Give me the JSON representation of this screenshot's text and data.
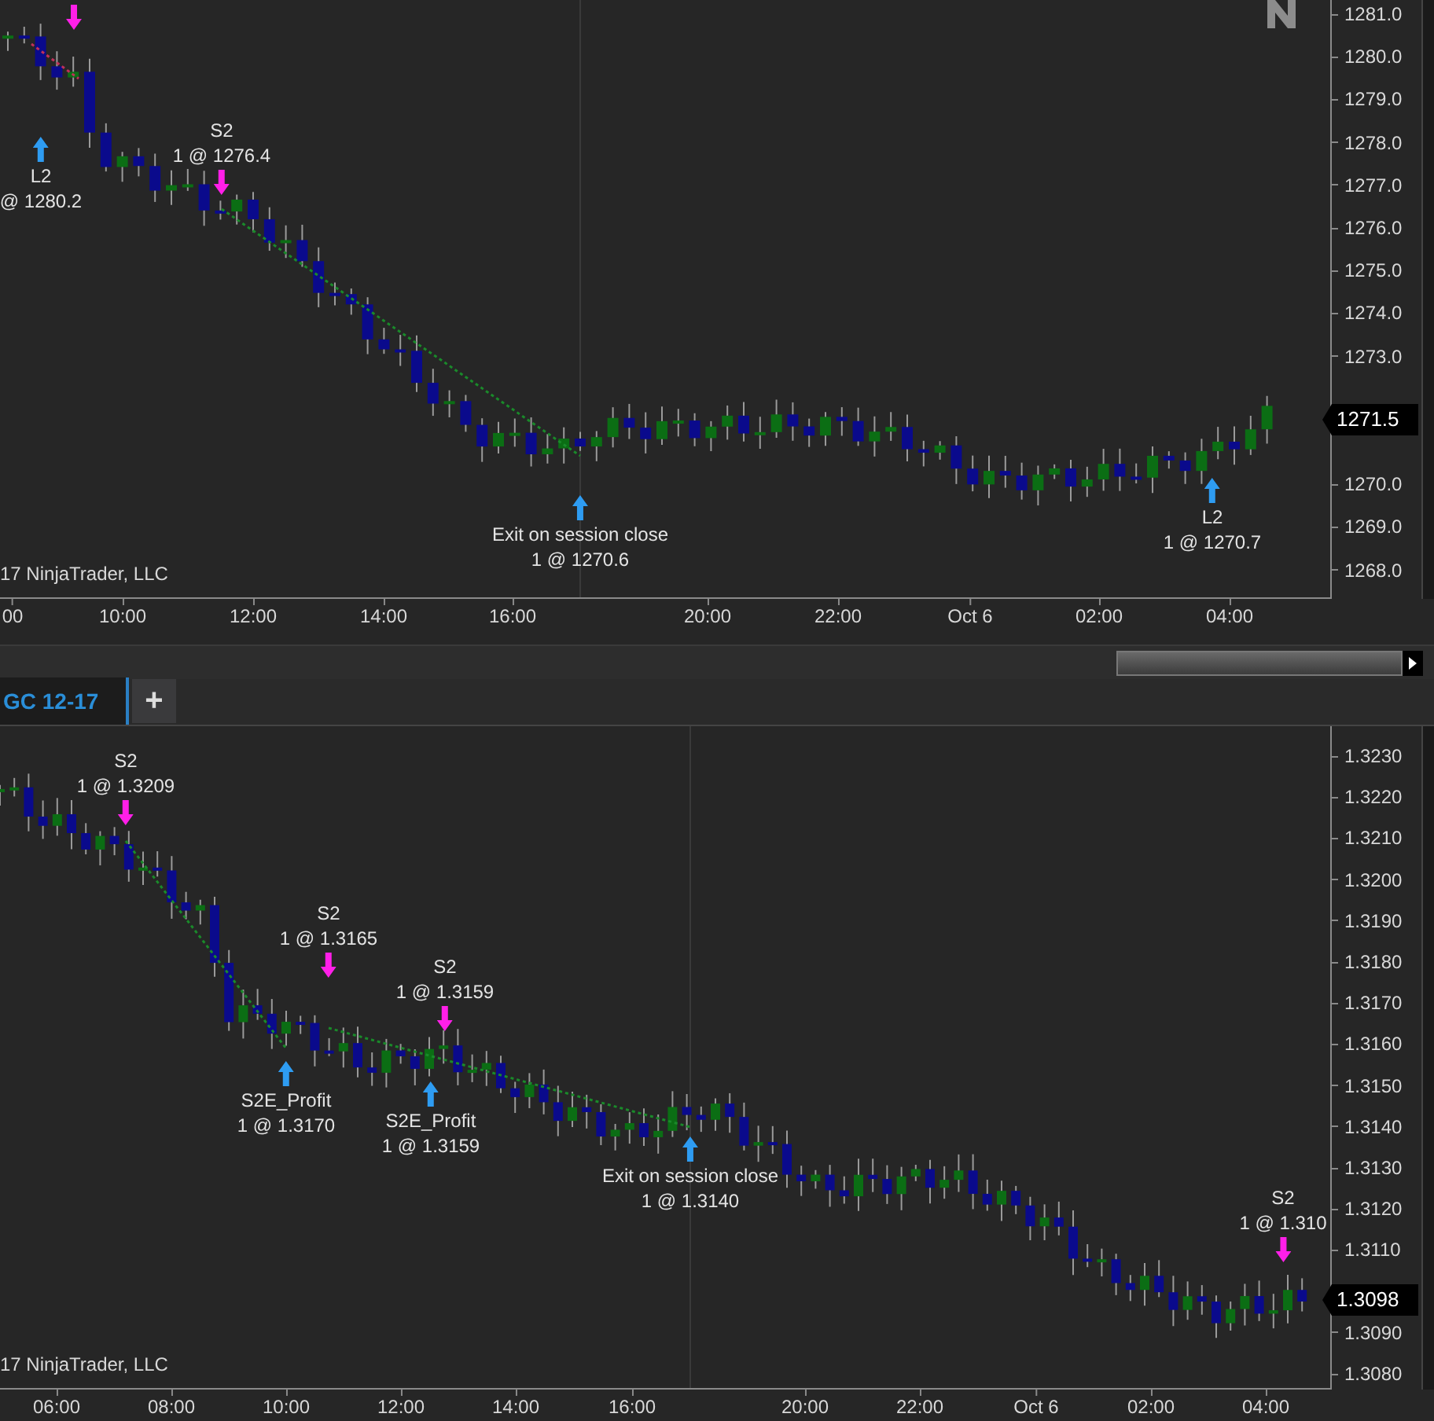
{
  "top_chart": {
    "copyright": "17 NinjaTrader, LLC",
    "price_axis": {
      "labels": [
        "1281.0",
        "1280.0",
        "1279.0",
        "1278.0",
        "1277.0",
        "1276.0",
        "1275.0",
        "1274.0",
        "1273.0",
        "1270.0",
        "1269.0",
        "1268.0"
      ],
      "current_price": "1271.5"
    },
    "time_axis": [
      "00",
      "10:00",
      "12:00",
      "14:00",
      "16:00",
      "20:00",
      "22:00",
      "Oct 6",
      "02:00",
      "04:00"
    ],
    "trades": [
      {
        "kind": "sell"
      },
      {
        "kind": "buy",
        "label": "L2",
        "detail": "@ 1280.2"
      },
      {
        "kind": "sell",
        "label": "S2",
        "detail": "1 @ 1276.4"
      },
      {
        "kind": "buy",
        "label": "Exit on session close",
        "detail": "1 @ 1270.6"
      },
      {
        "kind": "buy",
        "label": "L2",
        "detail": "1 @ 1270.7"
      }
    ]
  },
  "tabs": [
    {
      "label": "GC 12-17",
      "selected": true
    }
  ],
  "add_tab_button": "+",
  "bottom_chart": {
    "copyright": "17 NinjaTrader, LLC",
    "price_axis": {
      "labels": [
        "1.3230",
        "1.3220",
        "1.3210",
        "1.3200",
        "1.3190",
        "1.3180",
        "1.3170",
        "1.3160",
        "1.3150",
        "1.3140",
        "1.3130",
        "1.3120",
        "1.3110",
        "1.3090",
        "1.3080"
      ],
      "current_price": "1.3098"
    },
    "time_axis": [
      "06:00",
      "08:00",
      "10:00",
      "12:00",
      "14:00",
      "16:00",
      "20:00",
      "22:00",
      "Oct 6",
      "02:00",
      "04:00"
    ],
    "trades": [
      {
        "kind": "sell",
        "label": "S2",
        "detail": "1 @ 1.3209"
      },
      {
        "kind": "sell",
        "label": "S2",
        "detail": "1 @ 1.3165"
      },
      {
        "kind": "sell",
        "label": "S2",
        "detail": "1 @ 1.3159"
      },
      {
        "kind": "buy",
        "label": "S2E_Profit",
        "detail": "1 @ 1.3170"
      },
      {
        "kind": "buy",
        "label": "S2E_Profit",
        "detail": "1 @ 1.3159"
      },
      {
        "kind": "buy",
        "label": "Exit on session close",
        "detail": "1 @ 1.3140"
      },
      {
        "kind": "sell",
        "label": "S2",
        "detail": "1 @ 1.310"
      }
    ]
  }
}
